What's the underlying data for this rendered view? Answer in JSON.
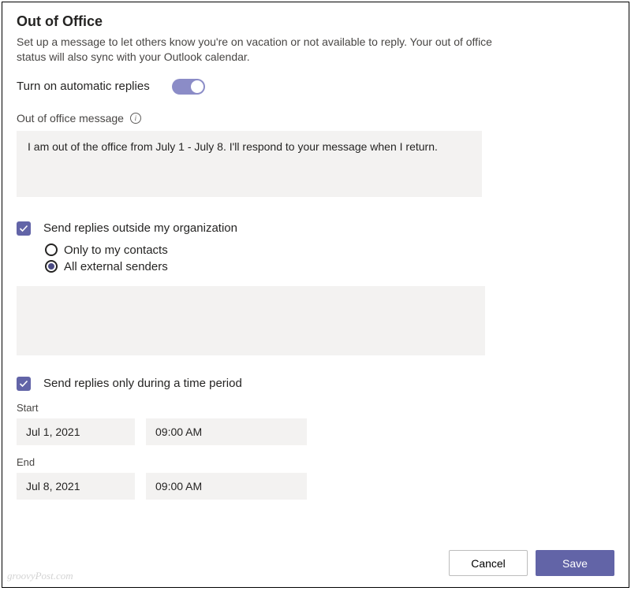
{
  "title": "Out of Office",
  "subtitle": "Set up a message to let others know you're on vacation or not available to reply. Your out of office status will also sync with your Outlook calendar.",
  "toggle": {
    "label": "Turn on automatic replies",
    "on": true
  },
  "message": {
    "label": "Out of office message",
    "value": "I am out of the office from July 1 - July 8. I'll respond to your message when I return."
  },
  "external": {
    "checkbox_label": "Send replies outside my organization",
    "checked": true,
    "options": {
      "contacts": "Only to my contacts",
      "all": "All external senders"
    },
    "selected": "all",
    "message_value": ""
  },
  "period": {
    "checkbox_label": "Send replies only during a time period",
    "checked": true,
    "start_label": "Start",
    "start_date": "Jul 1, 2021",
    "start_time": "09:00 AM",
    "end_label": "End",
    "end_date": "Jul 8, 2021",
    "end_time": "09:00 AM"
  },
  "buttons": {
    "cancel": "Cancel",
    "save": "Save"
  },
  "watermark": "groovyPost.com"
}
